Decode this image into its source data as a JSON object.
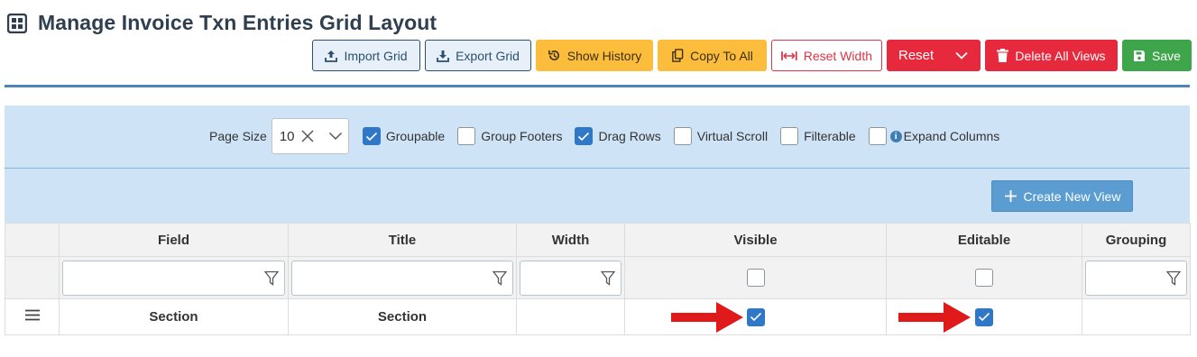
{
  "page": {
    "title": "Manage Invoice Txn Entries Grid Layout",
    "title_icon": "grid-icon"
  },
  "toolbar": {
    "import_label": "Import Grid",
    "export_label": "Export Grid",
    "history_label": "Show History",
    "copy_label": "Copy To All",
    "reset_width_label": "Reset Width",
    "reset_label": "Reset",
    "delete_views_label": "Delete All Views",
    "save_label": "Save"
  },
  "options": {
    "page_size_label": "Page Size",
    "page_size_value": "10",
    "groupable": {
      "label": "Groupable",
      "checked": true
    },
    "group_footers": {
      "label": "Group Footers",
      "checked": false
    },
    "drag_rows": {
      "label": "Drag Rows",
      "checked": true
    },
    "virtual_scroll": {
      "label": "Virtual Scroll",
      "checked": false
    },
    "filterable": {
      "label": "Filterable",
      "checked": false
    },
    "expand_columns": {
      "label": "Expand Columns",
      "checked": false
    }
  },
  "create_view_label": "Create New View",
  "grid": {
    "columns": [
      "Field",
      "Title",
      "Width",
      "Visible",
      "Editable",
      "Grouping"
    ],
    "rows": [
      {
        "field": "Section",
        "title": "Section",
        "width": "",
        "visible": true,
        "editable": true,
        "grouping": ""
      }
    ]
  },
  "colors": {
    "accent": "#2f78c8",
    "annotation_arrow": "#e01a1a"
  }
}
